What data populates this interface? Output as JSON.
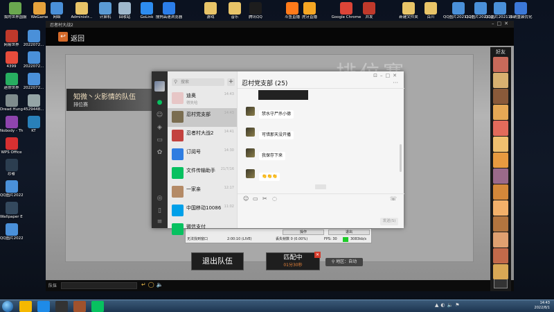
{
  "desktop": {
    "top_icons": [
      {
        "label": "我的世界国服",
        "icon": "minecraft-icon",
        "color": "#6aa84f"
      },
      {
        "label": "WeGame",
        "icon": "wegame-icon",
        "color": "#e6a23c"
      },
      {
        "label": "网络",
        "icon": "network-icon",
        "color": "#4a90d9"
      },
      {
        "label": "Administr...",
        "icon": "user-folder-icon",
        "color": "#e8c468"
      },
      {
        "label": "计算机",
        "icon": "computer-icon",
        "color": "#5b9bd5"
      },
      {
        "label": "回收站",
        "icon": "recycle-bin-icon",
        "color": "#9fb8cc"
      },
      {
        "label": "GoLink",
        "icon": "golink-icon",
        "color": "#2d8cf0"
      },
      {
        "label": "搜狗高速浏览器",
        "icon": "sogou-browser-icon",
        "color": "#2b7de9"
      },
      {
        "label": "游戏",
        "icon": "games-folder-icon",
        "color": "#e8c468"
      },
      {
        "label": "音乐",
        "icon": "music-folder-icon",
        "color": "#e8c468"
      },
      {
        "label": "腾讯QQ",
        "icon": "qq-icon",
        "color": "#1d1d1d"
      },
      {
        "label": "斗鱼直播",
        "icon": "douyu-icon",
        "color": "#ff7a1a"
      },
      {
        "label": "虎牙直播",
        "icon": "huya-icon",
        "color": "#f5a623"
      },
      {
        "label": "Google Chrome",
        "icon": "chrome-icon",
        "color": "#db4437"
      },
      {
        "label": "并发",
        "icon": "app-icon",
        "color": "#c0392b"
      },
      {
        "label": "新建文件夹",
        "icon": "new-folder-icon",
        "color": "#e8c468"
      },
      {
        "label": "百川",
        "icon": "folder-icon",
        "color": "#e8c468"
      },
      {
        "label": "QQ图片2021127...",
        "icon": "image-icon",
        "color": "#4a90d9"
      },
      {
        "label": "QQ图片202112...",
        "icon": "image-icon",
        "color": "#4a90d9"
      },
      {
        "label": "QQ图片202112...",
        "icon": "image-icon",
        "color": "#4a90d9"
      },
      {
        "label": "系统重装优化",
        "icon": "tool-icon",
        "color": "#3c78d8"
      }
    ],
    "left_icons": [
      {
        "label": "网易世界",
        "icon": "netease-icon",
        "color": "#c0392b"
      },
      {
        "label": "2022072...",
        "icon": "image-icon",
        "color": "#4a90d9"
      },
      {
        "label": "4399",
        "icon": "game-4399-icon",
        "color": "#e74c3c"
      },
      {
        "label": "2022072...",
        "icon": "image-icon",
        "color": "#4a90d9"
      },
      {
        "label": "迷你世界",
        "icon": "mini-world-icon",
        "color": "#27ae60"
      },
      {
        "label": "2022072...",
        "icon": "image-icon",
        "color": "#4a90d9"
      },
      {
        "label": "Dread Hunger",
        "icon": "dread-hunger-icon",
        "color": "#7f8c8d"
      },
      {
        "label": "4529448...",
        "icon": "file-icon",
        "color": "#95a5a6"
      },
      {
        "label": "Nobody - The Turna...",
        "icon": "game-icon",
        "color": "#8e44ad"
      },
      {
        "label": "KT",
        "icon": "kt-icon",
        "color": "#2980b9"
      },
      {
        "label": "WPS Office",
        "icon": "wps-icon",
        "color": "#d63031"
      },
      {
        "label": "忍者",
        "icon": "ninja-game-icon",
        "color": "#2c3e50"
      },
      {
        "label": "QQ图片2022072...",
        "icon": "image-icon",
        "color": "#4a90d9"
      },
      {
        "label": "Wallpaper Engine",
        "icon": "wallpaper-engine-icon",
        "color": "#34495e"
      },
      {
        "label": "QQ图片2022072...",
        "icon": "image-icon",
        "color": "#4a90d9"
      }
    ]
  },
  "game": {
    "window_title": "忍者村大战2",
    "back_label": "返回",
    "watermark": "排位赛",
    "team_title": "知微丶火影情的队伍",
    "team_mode": "排位赛",
    "exit_label": "退出队伍",
    "match_label": "匹配中",
    "match_timer": "01分30秒",
    "region_label": "地区：自动",
    "chat_label": "队伍"
  },
  "wechat": {
    "search_placeholder": "搜索",
    "conversations": [
      {
        "name": "迪奥",
        "preview": "得失哈",
        "time": "14:43",
        "color": "#e7c6c6",
        "active": false
      },
      {
        "name": "忍村党支部",
        "preview": "",
        "time": "14:43",
        "color": "#7a6d50",
        "active": true
      },
      {
        "name": "忍者村大战2",
        "preview": "",
        "time": "14:41",
        "color": "#c3423f",
        "active": false
      },
      {
        "name": "订阅号",
        "preview": "",
        "time": "14:30",
        "color": "#2f7de1",
        "active": false
      },
      {
        "name": "文件传输助手",
        "preview": "",
        "time": "21/7/16",
        "color": "#07c160",
        "active": false
      },
      {
        "name": "一家亲",
        "preview": "",
        "time": "12:17",
        "color": "#b48a66",
        "active": false
      },
      {
        "name": "中国移动10086",
        "preview": "",
        "time": "11:02",
        "color": "#00a0e9",
        "active": false
      },
      {
        "name": "微信支付",
        "preview": "",
        "time": "",
        "color": "#07c160",
        "active": false
      }
    ],
    "chat_title": "忍村党支部 (25)",
    "messages": [
      {
        "text": "禁水守尸杀小德"
      },
      {
        "text": "可惜那天没开播"
      },
      {
        "text": "我保存下来"
      },
      {
        "text": "👏👏👏"
      }
    ],
    "send_label": "发送(S)"
  },
  "obs": {
    "btn_left": "操作",
    "btn_right": "退出",
    "status_scene": "无法找到窗口",
    "status_time": "2:00:10 (LIVE)",
    "status_frames": "丢失帧数 0 (0.00%)",
    "status_fps": "FPS: 30",
    "status_rate": "3083kb/s"
  },
  "friends": {
    "title": "好友",
    "avatars": [
      "#c96a5a",
      "#d8b070",
      "#8a5a3a",
      "#e6a855",
      "#e26b5b",
      "#f0c070",
      "#e89a40",
      "#9a6a8a",
      "#d4883a",
      "#f2b06a",
      "#b3753f",
      "#e0a070",
      "#c26a4a",
      "#d9a855"
    ]
  },
  "taskbar": {
    "apps": [
      {
        "icon": "qq-browser-icon",
        "color": "#f5b800"
      },
      {
        "icon": "kugou-icon",
        "color": "#1e8be8"
      },
      {
        "icon": "obs-icon",
        "color": "#333333"
      },
      {
        "icon": "ninja-game-icon",
        "color": "#a0522d"
      },
      {
        "icon": "wechat-icon",
        "color": "#07c160"
      }
    ],
    "clock_time": "14:43",
    "clock_date": "2022/8/1"
  }
}
